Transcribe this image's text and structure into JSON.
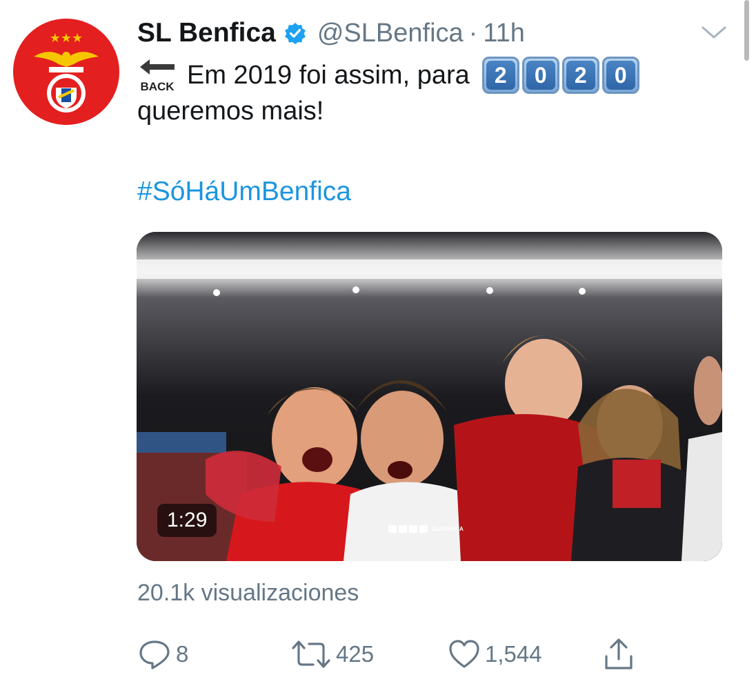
{
  "author": {
    "name": "SL Benfica",
    "handle": "@SLBenfica",
    "separator": "·",
    "time": "11h",
    "verified": true,
    "avatar_icon": "benfica-crest-icon"
  },
  "tweet": {
    "emoji_back": "BACK",
    "line1": "Em 2019 foi assim, para",
    "keycaps": [
      "2",
      "0",
      "2",
      "0"
    ],
    "line2": "queremos mais!",
    "hashtag": "#SóHáUmBenfica"
  },
  "media": {
    "type": "video",
    "duration": "1:29",
    "watermark_text": "SLBENFICA"
  },
  "views": "20.1k visualizaciones",
  "actions": {
    "reply": {
      "icon": "reply-icon",
      "count": "8"
    },
    "retweet": {
      "icon": "retweet-icon",
      "count": "425"
    },
    "like": {
      "icon": "heart-icon",
      "count": "1,544"
    },
    "share": {
      "icon": "share-icon"
    }
  },
  "colors": {
    "text": "#14171a",
    "secondary": "#657786",
    "link": "#1b95e0",
    "verified": "#1da1f2",
    "avatar_bg": "#e41f1f"
  }
}
